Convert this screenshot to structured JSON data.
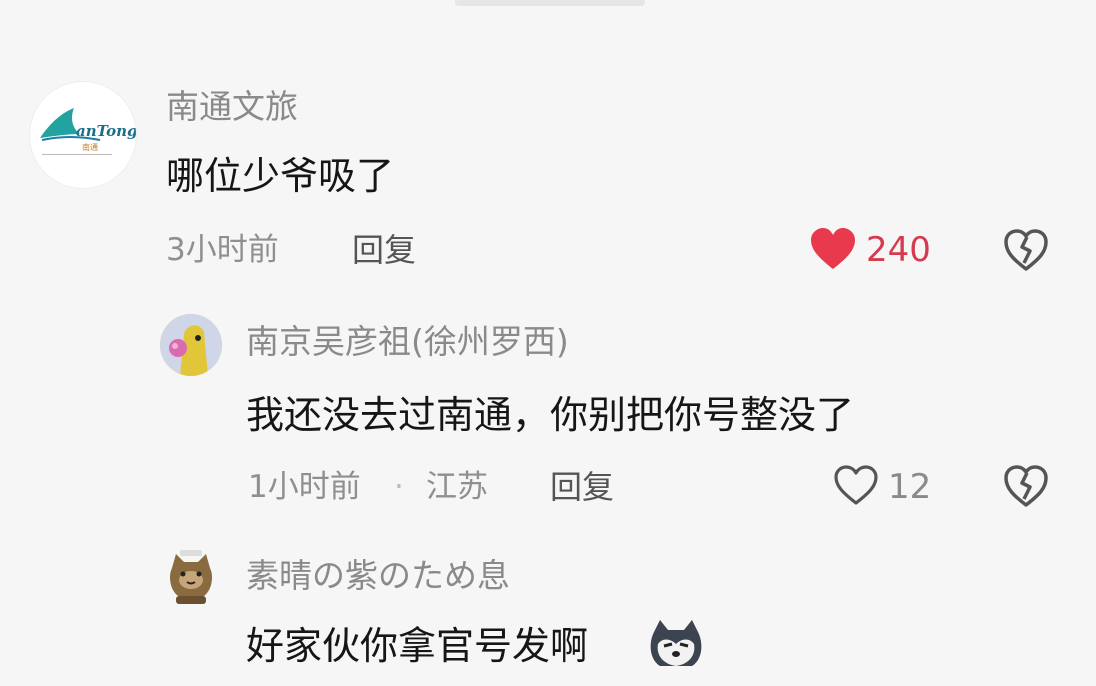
{
  "comments": [
    {
      "name": "南通文旅",
      "avatar_logo": "BanTong 南通",
      "text": "哪位少爷吸了",
      "time": "3小时前",
      "reply_label": "回复",
      "likes": "240",
      "liked": true,
      "like_icon": "heart-filled-icon",
      "dislike_icon": "broken-heart-icon"
    },
    {
      "name": "南京吴彦祖(徐州罗西)",
      "text": "我还没去过南通，你别把你号整没了",
      "time": "1小时前",
      "separator": "·",
      "location": "江苏",
      "reply_label": "回复",
      "likes": "12",
      "liked": false,
      "like_icon": "heart-outline-icon",
      "dislike_icon": "broken-heart-icon"
    },
    {
      "name": "素晴の紫のため息",
      "text": "好家伙你拿官号发啊",
      "emoji_icon": "husky-emoji-icon"
    }
  ],
  "colors": {
    "like_active": "#e8394d",
    "text_primary": "#161616",
    "text_secondary": "#8a8a8a"
  }
}
